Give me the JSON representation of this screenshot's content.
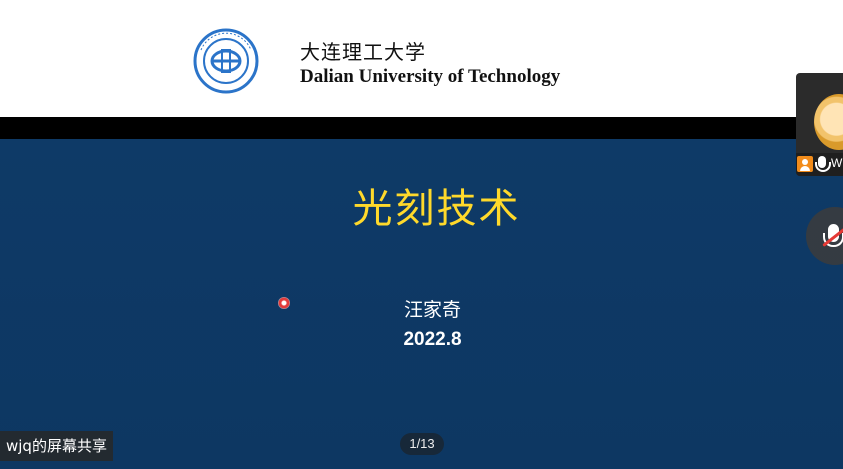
{
  "header": {
    "university_cn": "大连理工大学",
    "university_en": "Dalian University of Technology"
  },
  "slide": {
    "title": "光刻技术",
    "author": "汪家奇",
    "date": "2022.8"
  },
  "share": {
    "label": "wjq的屏幕共享",
    "page_indicator": "1/13"
  },
  "participant": {
    "name_initial": "W",
    "mic_state": "on"
  },
  "controls": {
    "mute_state": "muted"
  },
  "colors": {
    "slide_background": "#0f3a66",
    "title_color": "#ffd92b",
    "header_background": "#ffffff"
  }
}
